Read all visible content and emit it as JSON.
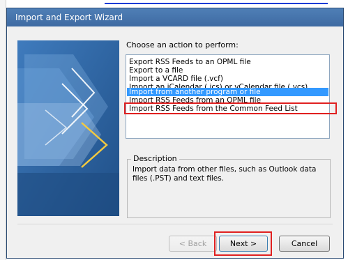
{
  "window": {
    "title": "Import and Export Wizard"
  },
  "prompt": "Choose an action to perform:",
  "actions": [
    "Export RSS Feeds to an OPML file",
    "Export to a file",
    "Import a VCARD file (.vcf)",
    "Import an iCalendar (.ics) or vCalendar file (.vcs)",
    "Import from another program or file",
    "Import RSS Feeds from an OPML file",
    "Import RSS Feeds from the Common Feed List"
  ],
  "selected_action": "Import from another program or file",
  "description": {
    "title": "Description",
    "text": "Import data from other files, such as Outlook data files (.PST) and text files."
  },
  "buttons": {
    "back": "< Back",
    "next": "Next >",
    "cancel": "Cancel"
  },
  "colors": {
    "titlebar": "#4f7fb6",
    "selection": "#3399ff",
    "highlight": "#e02020"
  }
}
